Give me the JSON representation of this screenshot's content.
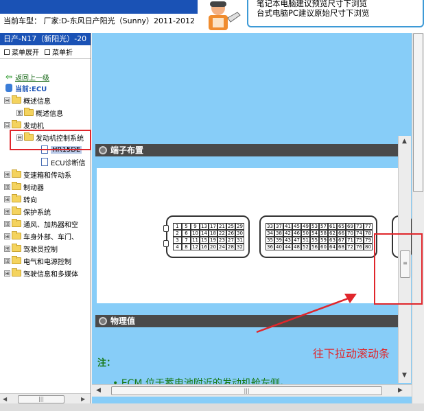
{
  "header": {
    "car_label": "当前车型：",
    "car_value": "厂家:D-东风日产阳光（Sunny）2011-2012",
    "tip_line1": "笔记本电脑建议预览尺寸下浏览",
    "tip_line2": "台式电脑PC建议原始尺寸下浏览"
  },
  "left": {
    "title": "日产-N17（新阳光）-20",
    "toolbar_expand": "菜单展开",
    "toolbar_collapse": "菜单折",
    "back_link": "返回上一级",
    "current": "当前:ECU",
    "tree": [
      {
        "label": "概述信息",
        "expander": "⊟",
        "kind": "folder"
      },
      {
        "label": "概述信息",
        "expander": "⊞",
        "kind": "folder"
      },
      {
        "label": "发动机",
        "expander": "⊟",
        "kind": "folder"
      },
      {
        "label": "发动机控制系统",
        "expander": "⊟",
        "kind": "folder"
      },
      {
        "label": "HR15DE",
        "expander": "",
        "kind": "doc"
      },
      {
        "label": "ECU诊断信",
        "expander": "",
        "kind": "doc"
      },
      {
        "label": "变速箱和传动系",
        "expander": "⊞",
        "kind": "folder"
      },
      {
        "label": "制动器",
        "expander": "⊞",
        "kind": "folder"
      },
      {
        "label": "转向",
        "expander": "⊞",
        "kind": "folder"
      },
      {
        "label": "保护系统",
        "expander": "⊞",
        "kind": "folder"
      },
      {
        "label": "通风、加热器和空",
        "expander": "⊞",
        "kind": "folder"
      },
      {
        "label": "车身外部、车门、",
        "expander": "⊞",
        "kind": "folder"
      },
      {
        "label": "驾驶员控制",
        "expander": "⊞",
        "kind": "folder"
      },
      {
        "label": "电气和电源控制",
        "expander": "⊞",
        "kind": "folder"
      },
      {
        "label": "驾驶信息和多媒体",
        "expander": "⊞",
        "kind": "folder"
      }
    ]
  },
  "main": {
    "section1": "端子布置",
    "section2": "物理值",
    "note_title": "注：",
    "note_line": "•  ECM 位于蓄电池附近的发动机舱左侧。"
  },
  "connector1": {
    "rows": [
      [
        "1",
        "5",
        "9",
        "13",
        "17",
        "21",
        "25",
        "29"
      ],
      [
        "2",
        "6",
        "10",
        "14",
        "18",
        "22",
        "26",
        "30"
      ],
      [
        "3",
        "7",
        "11",
        "15",
        "19",
        "23",
        "27",
        "31"
      ],
      [
        "4",
        "8",
        "12",
        "16",
        "20",
        "24",
        "28",
        "32"
      ]
    ]
  },
  "connector2": {
    "rows": [
      [
        "33",
        "37",
        "41",
        "45",
        "49",
        "53",
        "57",
        "61",
        "65",
        "69",
        "73",
        "77"
      ],
      [
        "34",
        "38",
        "42",
        "46",
        "50",
        "54",
        "58",
        "62",
        "66",
        "70",
        "74",
        "78"
      ],
      [
        "35",
        "39",
        "43",
        "47",
        "51",
        "55",
        "59",
        "63",
        "67",
        "71",
        "75",
        "79"
      ],
      [
        "36",
        "40",
        "44",
        "48",
        "52",
        "56",
        "60",
        "64",
        "68",
        "72",
        "76",
        "80"
      ]
    ]
  },
  "annotation": {
    "text": "往下拉动滚动条"
  },
  "colors": {
    "title_blue": "#1a52b5",
    "content_bg": "#87cdf8",
    "annotation_red": "#e0262b"
  }
}
